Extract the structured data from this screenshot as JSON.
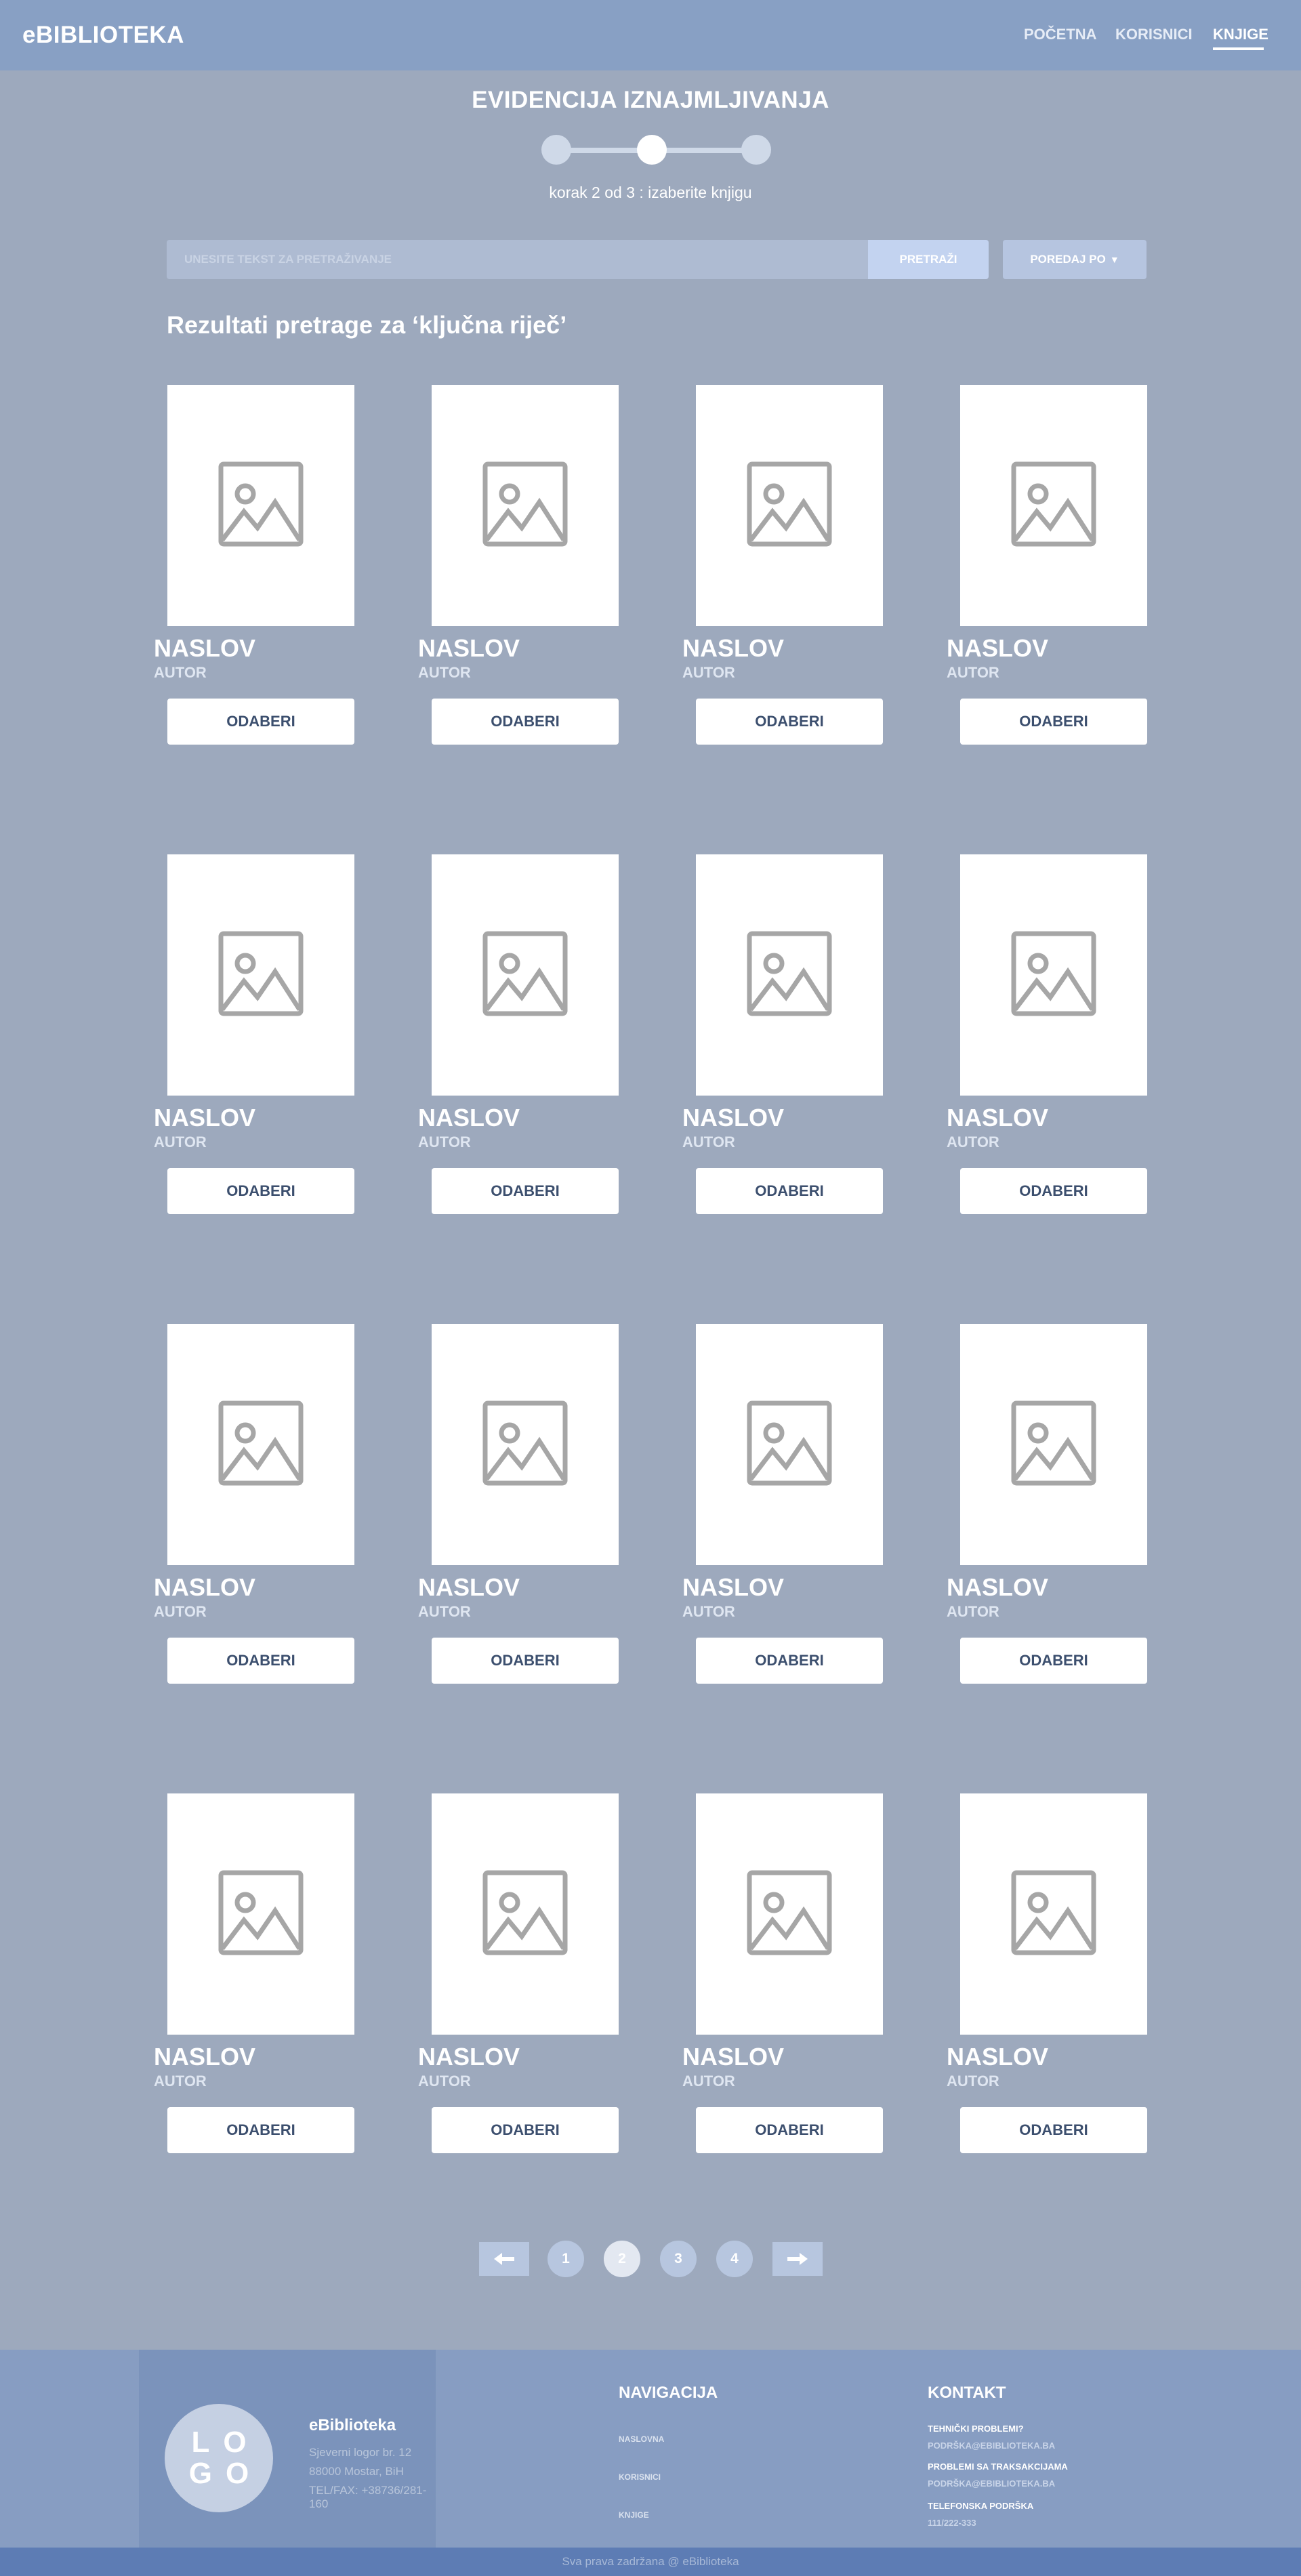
{
  "header": {
    "brand": "eBIBLIOTEKA",
    "nav": [
      {
        "label": "POČETNA",
        "active": false
      },
      {
        "label": "KORISNICI",
        "active": false
      },
      {
        "label": "KNJIGE",
        "active": true
      }
    ]
  },
  "wizard": {
    "title": "EVIDENCIJA IZNAJMLJIVANJA",
    "current_step": 2,
    "total_steps": 3,
    "step_text": "korak 2 od 3 : izaberite knjigu"
  },
  "search": {
    "placeholder": "UNESITE TEKST ZA PRETRAŽIVANJE",
    "button_label": "PRETRAŽI",
    "sort_label": "POREDAJ PO"
  },
  "results": {
    "heading": "Rezultati pretrage za ‘ključna riječ’",
    "books": [
      {
        "title": "NASLOV",
        "author": "AUTOR",
        "button": "ODABERI"
      },
      {
        "title": "NASLOV",
        "author": "AUTOR",
        "button": "ODABERI"
      },
      {
        "title": "NASLOV",
        "author": "AUTOR",
        "button": "ODABERI"
      },
      {
        "title": "NASLOV",
        "author": "AUTOR",
        "button": "ODABERI"
      },
      {
        "title": "NASLOV",
        "author": "AUTOR",
        "button": "ODABERI"
      },
      {
        "title": "NASLOV",
        "author": "AUTOR",
        "button": "ODABERI"
      },
      {
        "title": "NASLOV",
        "author": "AUTOR",
        "button": "ODABERI"
      },
      {
        "title": "NASLOV",
        "author": "AUTOR",
        "button": "ODABERI"
      },
      {
        "title": "NASLOV",
        "author": "AUTOR",
        "button": "ODABERI"
      },
      {
        "title": "NASLOV",
        "author": "AUTOR",
        "button": "ODABERI"
      },
      {
        "title": "NASLOV",
        "author": "AUTOR",
        "button": "ODABERI"
      },
      {
        "title": "NASLOV",
        "author": "AUTOR",
        "button": "ODABERI"
      },
      {
        "title": "NASLOV",
        "author": "AUTOR",
        "button": "ODABERI"
      },
      {
        "title": "NASLOV",
        "author": "AUTOR",
        "button": "ODABERI"
      },
      {
        "title": "NASLOV",
        "author": "AUTOR",
        "button": "ODABERI"
      },
      {
        "title": "NASLOV",
        "author": "AUTOR",
        "button": "ODABERI"
      }
    ]
  },
  "pagination": {
    "pages": [
      "1",
      "2",
      "3",
      "4"
    ],
    "current": "2",
    "prev_icon": "arrow-left-icon",
    "next_icon": "arrow-right-icon"
  },
  "footer": {
    "logo_lines": [
      "LO",
      "GO"
    ],
    "name": "eBiblioteka",
    "address": [
      "Sjeverni logor br. 12",
      "88000 Mostar, BiH",
      "TEL/FAX: +38736/281-160"
    ],
    "navigation": {
      "heading": "NAVIGACIJA",
      "links": [
        "NASLOVNA",
        "KORISNICI",
        "KNJIGE"
      ]
    },
    "contact": {
      "heading": "KONTAKT",
      "entries": [
        {
          "label": "TEHNIČKI PROBLEMI?",
          "value": "PODRŠKA@EBIBLIOTEKA.BA"
        },
        {
          "label": "PROBLEMI SA TRAKSAKCIJAMA",
          "value": "PODRŠKA@EBIBLIOTEKA.BA"
        },
        {
          "label": "TELEFONSKA PODRŠKA",
          "value": "111/222-333"
        }
      ]
    },
    "copyright": "Sva prava zadržana @ eBiblioteka"
  },
  "colors": {
    "page_bg": "#9da9bd",
    "header_bg": "#88a0c4",
    "footer_bg": "#879dc2",
    "copyright_bg": "#5d7cb4",
    "button_text": "#3c4f6e"
  }
}
